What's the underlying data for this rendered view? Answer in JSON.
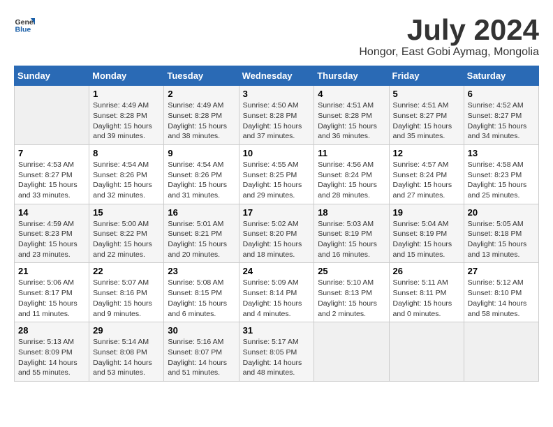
{
  "logo": {
    "general": "General",
    "blue": "Blue"
  },
  "title": "July 2024",
  "subtitle": "Hongor, East Gobi Aymag, Mongolia",
  "days_of_week": [
    "Sunday",
    "Monday",
    "Tuesday",
    "Wednesday",
    "Thursday",
    "Friday",
    "Saturday"
  ],
  "weeks": [
    [
      {
        "day": "",
        "info": ""
      },
      {
        "day": "1",
        "info": "Sunrise: 4:49 AM\nSunset: 8:28 PM\nDaylight: 15 hours and 39 minutes."
      },
      {
        "day": "2",
        "info": "Sunrise: 4:49 AM\nSunset: 8:28 PM\nDaylight: 15 hours and 38 minutes."
      },
      {
        "day": "3",
        "info": "Sunrise: 4:50 AM\nSunset: 8:28 PM\nDaylight: 15 hours and 37 minutes."
      },
      {
        "day": "4",
        "info": "Sunrise: 4:51 AM\nSunset: 8:28 PM\nDaylight: 15 hours and 36 minutes."
      },
      {
        "day": "5",
        "info": "Sunrise: 4:51 AM\nSunset: 8:27 PM\nDaylight: 15 hours and 35 minutes."
      },
      {
        "day": "6",
        "info": "Sunrise: 4:52 AM\nSunset: 8:27 PM\nDaylight: 15 hours and 34 minutes."
      }
    ],
    [
      {
        "day": "7",
        "info": "Sunrise: 4:53 AM\nSunset: 8:27 PM\nDaylight: 15 hours and 33 minutes."
      },
      {
        "day": "8",
        "info": "Sunrise: 4:54 AM\nSunset: 8:26 PM\nDaylight: 15 hours and 32 minutes."
      },
      {
        "day": "9",
        "info": "Sunrise: 4:54 AM\nSunset: 8:26 PM\nDaylight: 15 hours and 31 minutes."
      },
      {
        "day": "10",
        "info": "Sunrise: 4:55 AM\nSunset: 8:25 PM\nDaylight: 15 hours and 29 minutes."
      },
      {
        "day": "11",
        "info": "Sunrise: 4:56 AM\nSunset: 8:24 PM\nDaylight: 15 hours and 28 minutes."
      },
      {
        "day": "12",
        "info": "Sunrise: 4:57 AM\nSunset: 8:24 PM\nDaylight: 15 hours and 27 minutes."
      },
      {
        "day": "13",
        "info": "Sunrise: 4:58 AM\nSunset: 8:23 PM\nDaylight: 15 hours and 25 minutes."
      }
    ],
    [
      {
        "day": "14",
        "info": "Sunrise: 4:59 AM\nSunset: 8:23 PM\nDaylight: 15 hours and 23 minutes."
      },
      {
        "day": "15",
        "info": "Sunrise: 5:00 AM\nSunset: 8:22 PM\nDaylight: 15 hours and 22 minutes."
      },
      {
        "day": "16",
        "info": "Sunrise: 5:01 AM\nSunset: 8:21 PM\nDaylight: 15 hours and 20 minutes."
      },
      {
        "day": "17",
        "info": "Sunrise: 5:02 AM\nSunset: 8:20 PM\nDaylight: 15 hours and 18 minutes."
      },
      {
        "day": "18",
        "info": "Sunrise: 5:03 AM\nSunset: 8:19 PM\nDaylight: 15 hours and 16 minutes."
      },
      {
        "day": "19",
        "info": "Sunrise: 5:04 AM\nSunset: 8:19 PM\nDaylight: 15 hours and 15 minutes."
      },
      {
        "day": "20",
        "info": "Sunrise: 5:05 AM\nSunset: 8:18 PM\nDaylight: 15 hours and 13 minutes."
      }
    ],
    [
      {
        "day": "21",
        "info": "Sunrise: 5:06 AM\nSunset: 8:17 PM\nDaylight: 15 hours and 11 minutes."
      },
      {
        "day": "22",
        "info": "Sunrise: 5:07 AM\nSunset: 8:16 PM\nDaylight: 15 hours and 9 minutes."
      },
      {
        "day": "23",
        "info": "Sunrise: 5:08 AM\nSunset: 8:15 PM\nDaylight: 15 hours and 6 minutes."
      },
      {
        "day": "24",
        "info": "Sunrise: 5:09 AM\nSunset: 8:14 PM\nDaylight: 15 hours and 4 minutes."
      },
      {
        "day": "25",
        "info": "Sunrise: 5:10 AM\nSunset: 8:13 PM\nDaylight: 15 hours and 2 minutes."
      },
      {
        "day": "26",
        "info": "Sunrise: 5:11 AM\nSunset: 8:11 PM\nDaylight: 15 hours and 0 minutes."
      },
      {
        "day": "27",
        "info": "Sunrise: 5:12 AM\nSunset: 8:10 PM\nDaylight: 14 hours and 58 minutes."
      }
    ],
    [
      {
        "day": "28",
        "info": "Sunrise: 5:13 AM\nSunset: 8:09 PM\nDaylight: 14 hours and 55 minutes."
      },
      {
        "day": "29",
        "info": "Sunrise: 5:14 AM\nSunset: 8:08 PM\nDaylight: 14 hours and 53 minutes."
      },
      {
        "day": "30",
        "info": "Sunrise: 5:16 AM\nSunset: 8:07 PM\nDaylight: 14 hours and 51 minutes."
      },
      {
        "day": "31",
        "info": "Sunrise: 5:17 AM\nSunset: 8:05 PM\nDaylight: 14 hours and 48 minutes."
      },
      {
        "day": "",
        "info": ""
      },
      {
        "day": "",
        "info": ""
      },
      {
        "day": "",
        "info": ""
      }
    ]
  ]
}
